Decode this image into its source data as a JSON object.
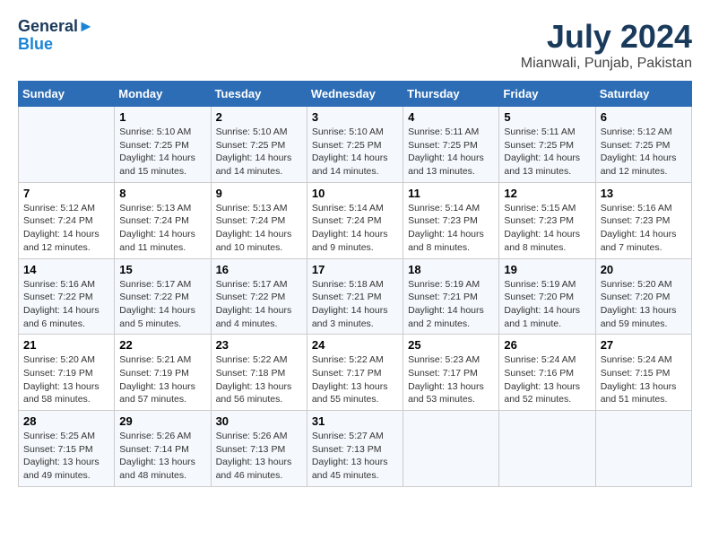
{
  "header": {
    "logo_line1": "General",
    "logo_line2": "Blue",
    "month": "July 2024",
    "location": "Mianwali, Punjab, Pakistan"
  },
  "days_of_week": [
    "Sunday",
    "Monday",
    "Tuesday",
    "Wednesday",
    "Thursday",
    "Friday",
    "Saturday"
  ],
  "weeks": [
    [
      {
        "date": "",
        "info": ""
      },
      {
        "date": "1",
        "info": "Sunrise: 5:10 AM\nSunset: 7:25 PM\nDaylight: 14 hours\nand 15 minutes."
      },
      {
        "date": "2",
        "info": "Sunrise: 5:10 AM\nSunset: 7:25 PM\nDaylight: 14 hours\nand 14 minutes."
      },
      {
        "date": "3",
        "info": "Sunrise: 5:10 AM\nSunset: 7:25 PM\nDaylight: 14 hours\nand 14 minutes."
      },
      {
        "date": "4",
        "info": "Sunrise: 5:11 AM\nSunset: 7:25 PM\nDaylight: 14 hours\nand 13 minutes."
      },
      {
        "date": "5",
        "info": "Sunrise: 5:11 AM\nSunset: 7:25 PM\nDaylight: 14 hours\nand 13 minutes."
      },
      {
        "date": "6",
        "info": "Sunrise: 5:12 AM\nSunset: 7:25 PM\nDaylight: 14 hours\nand 12 minutes."
      }
    ],
    [
      {
        "date": "7",
        "info": "Sunrise: 5:12 AM\nSunset: 7:24 PM\nDaylight: 14 hours\nand 12 minutes."
      },
      {
        "date": "8",
        "info": "Sunrise: 5:13 AM\nSunset: 7:24 PM\nDaylight: 14 hours\nand 11 minutes."
      },
      {
        "date": "9",
        "info": "Sunrise: 5:13 AM\nSunset: 7:24 PM\nDaylight: 14 hours\nand 10 minutes."
      },
      {
        "date": "10",
        "info": "Sunrise: 5:14 AM\nSunset: 7:24 PM\nDaylight: 14 hours\nand 9 minutes."
      },
      {
        "date": "11",
        "info": "Sunrise: 5:14 AM\nSunset: 7:23 PM\nDaylight: 14 hours\nand 8 minutes."
      },
      {
        "date": "12",
        "info": "Sunrise: 5:15 AM\nSunset: 7:23 PM\nDaylight: 14 hours\nand 8 minutes."
      },
      {
        "date": "13",
        "info": "Sunrise: 5:16 AM\nSunset: 7:23 PM\nDaylight: 14 hours\nand 7 minutes."
      }
    ],
    [
      {
        "date": "14",
        "info": "Sunrise: 5:16 AM\nSunset: 7:22 PM\nDaylight: 14 hours\nand 6 minutes."
      },
      {
        "date": "15",
        "info": "Sunrise: 5:17 AM\nSunset: 7:22 PM\nDaylight: 14 hours\nand 5 minutes."
      },
      {
        "date": "16",
        "info": "Sunrise: 5:17 AM\nSunset: 7:22 PM\nDaylight: 14 hours\nand 4 minutes."
      },
      {
        "date": "17",
        "info": "Sunrise: 5:18 AM\nSunset: 7:21 PM\nDaylight: 14 hours\nand 3 minutes."
      },
      {
        "date": "18",
        "info": "Sunrise: 5:19 AM\nSunset: 7:21 PM\nDaylight: 14 hours\nand 2 minutes."
      },
      {
        "date": "19",
        "info": "Sunrise: 5:19 AM\nSunset: 7:20 PM\nDaylight: 14 hours\nand 1 minute."
      },
      {
        "date": "20",
        "info": "Sunrise: 5:20 AM\nSunset: 7:20 PM\nDaylight: 13 hours\nand 59 minutes."
      }
    ],
    [
      {
        "date": "21",
        "info": "Sunrise: 5:20 AM\nSunset: 7:19 PM\nDaylight: 13 hours\nand 58 minutes."
      },
      {
        "date": "22",
        "info": "Sunrise: 5:21 AM\nSunset: 7:19 PM\nDaylight: 13 hours\nand 57 minutes."
      },
      {
        "date": "23",
        "info": "Sunrise: 5:22 AM\nSunset: 7:18 PM\nDaylight: 13 hours\nand 56 minutes."
      },
      {
        "date": "24",
        "info": "Sunrise: 5:22 AM\nSunset: 7:17 PM\nDaylight: 13 hours\nand 55 minutes."
      },
      {
        "date": "25",
        "info": "Sunrise: 5:23 AM\nSunset: 7:17 PM\nDaylight: 13 hours\nand 53 minutes."
      },
      {
        "date": "26",
        "info": "Sunrise: 5:24 AM\nSunset: 7:16 PM\nDaylight: 13 hours\nand 52 minutes."
      },
      {
        "date": "27",
        "info": "Sunrise: 5:24 AM\nSunset: 7:15 PM\nDaylight: 13 hours\nand 51 minutes."
      }
    ],
    [
      {
        "date": "28",
        "info": "Sunrise: 5:25 AM\nSunset: 7:15 PM\nDaylight: 13 hours\nand 49 minutes."
      },
      {
        "date": "29",
        "info": "Sunrise: 5:26 AM\nSunset: 7:14 PM\nDaylight: 13 hours\nand 48 minutes."
      },
      {
        "date": "30",
        "info": "Sunrise: 5:26 AM\nSunset: 7:13 PM\nDaylight: 13 hours\nand 46 minutes."
      },
      {
        "date": "31",
        "info": "Sunrise: 5:27 AM\nSunset: 7:13 PM\nDaylight: 13 hours\nand 45 minutes."
      },
      {
        "date": "",
        "info": ""
      },
      {
        "date": "",
        "info": ""
      },
      {
        "date": "",
        "info": ""
      }
    ]
  ]
}
